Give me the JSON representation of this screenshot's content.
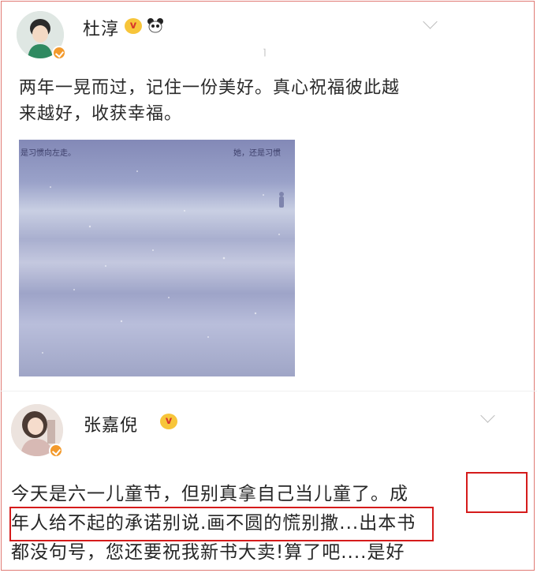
{
  "posts": [
    {
      "user": "杜淳",
      "text_lines": [
        "两年一晃而过，记住一份美好。真心祝福彼此越",
        "来越好，收获幸福。"
      ],
      "image_caption_left": "是习惯向左走。",
      "image_caption_right": "她，还是习惯"
    },
    {
      "user": "张嘉倪",
      "text_lines": [
        "今天是六一儿童节，但别真拿自己当儿童了。成",
        "年人给不起的承诺别说.画不圆的慌别撒...出本书",
        "都没句号，您还要祝我新书大卖!算了吧....是好"
      ]
    }
  ],
  "colors": {
    "highlight": "#d51b1b",
    "verified_badge": "#f39a2c"
  },
  "icons": [
    "verified-icon",
    "emoji-icon",
    "panda-icon",
    "chevron-down-icon"
  ]
}
